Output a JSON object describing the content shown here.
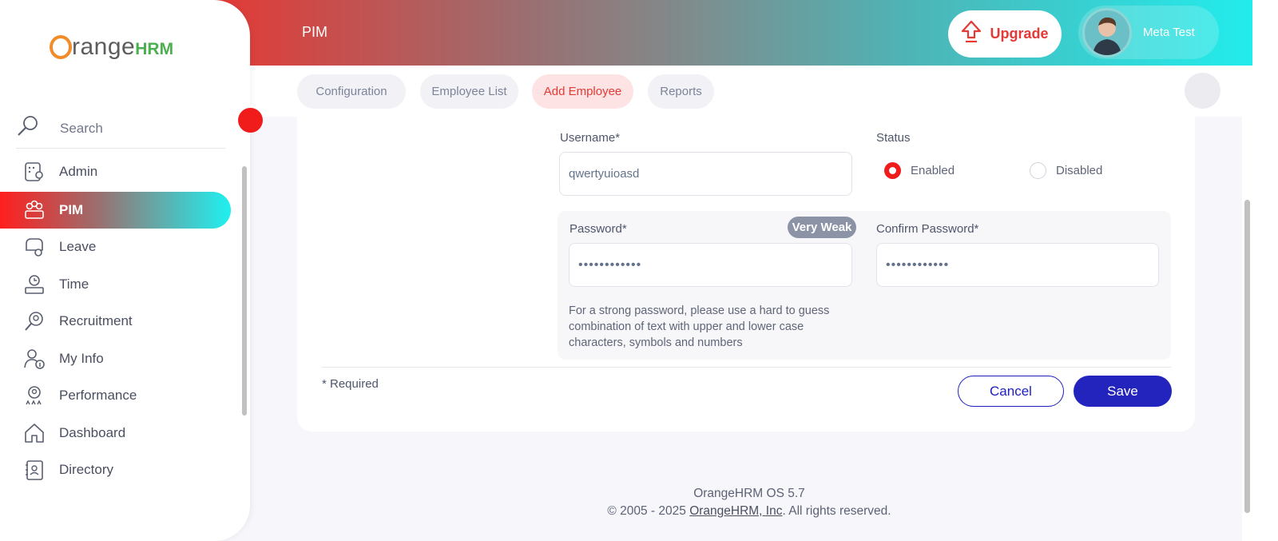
{
  "header": {
    "module_title": "PIM",
    "upgrade_label": "Upgrade",
    "user_name": "Meta Test"
  },
  "tabs": [
    {
      "label": "Configuration",
      "active": false
    },
    {
      "label": "Employee List",
      "active": false
    },
    {
      "label": "Add Employee",
      "active": true
    },
    {
      "label": "Reports",
      "active": false
    }
  ],
  "sidebar": {
    "logo_text": "range",
    "logo_hrm": "HRM",
    "search_label": "Search",
    "items": [
      {
        "label": "Admin",
        "icon": "admin-icon"
      },
      {
        "label": "PIM",
        "icon": "pim-icon",
        "active": true
      },
      {
        "label": "Leave",
        "icon": "leave-icon"
      },
      {
        "label": "Time",
        "icon": "time-icon"
      },
      {
        "label": "Recruitment",
        "icon": "recruitment-icon"
      },
      {
        "label": "My Info",
        "icon": "my-info-icon"
      },
      {
        "label": "Performance",
        "icon": "performance-icon"
      },
      {
        "label": "Dashboard",
        "icon": "dashboard-icon"
      },
      {
        "label": "Directory",
        "icon": "directory-icon"
      }
    ]
  },
  "form": {
    "username_label": "Username*",
    "username_value": "qwertyuioasd",
    "status_label": "Status",
    "status_enabled": "Enabled",
    "status_disabled": "Disabled",
    "status_selected": "Enabled",
    "password_label": "Password*",
    "password_value": "••••••••••••",
    "strength_badge": "Very Weak",
    "confirm_label": "Confirm Password*",
    "confirm_value": "••••••••••••",
    "hint": "For a strong password, please use a hard to guess combination of text with upper and lower case characters, symbols and numbers",
    "required_note": "* Required",
    "cancel_label": "Cancel",
    "save_label": "Save"
  },
  "footer": {
    "version": "OrangeHRM OS 5.7",
    "copyright_prefix": "© 2005 - 2025 ",
    "company_link": "OrangeHRM, Inc",
    "copyright_suffix": ". All rights reserved."
  },
  "colors": {
    "accent_red": "#e53935",
    "save_blue": "#2323bd"
  }
}
